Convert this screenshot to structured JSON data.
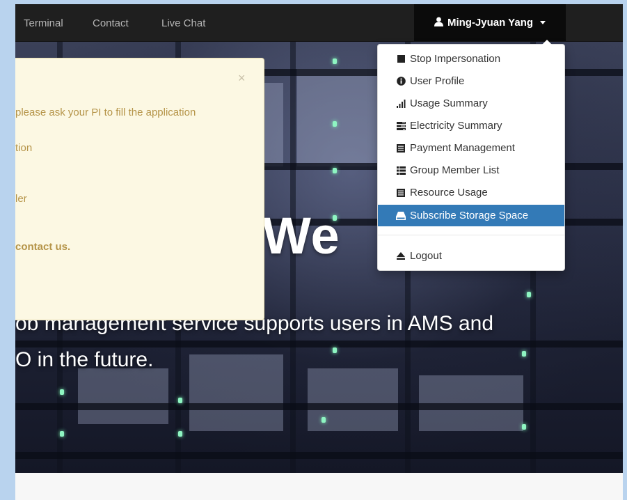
{
  "navbar": {
    "links": [
      "Terminal",
      "Contact",
      "Live Chat"
    ],
    "user_name": "Ming-Jyuan Yang"
  },
  "alert": {
    "close": "×",
    "lines": [
      "please ask your PI to fill the application",
      "tion",
      "ler",
      "contact us."
    ]
  },
  "hero": {
    "big_text": "We",
    "line1": "ob management service supports users in AMS and",
    "line2": "O in the future."
  },
  "user_menu": {
    "items": [
      {
        "label": "Stop Impersonation",
        "icon": "stop-icon"
      },
      {
        "label": "User Profile",
        "icon": "info-circle-icon"
      },
      {
        "label": "Usage Summary",
        "icon": "signal-bars-icon"
      },
      {
        "label": "Electricity Summary",
        "icon": "tasks-icon"
      },
      {
        "label": "Payment Management",
        "icon": "list-alt-icon"
      },
      {
        "label": "Group Member List",
        "icon": "th-list-icon"
      },
      {
        "label": "Resource Usage",
        "icon": "list-alt-icon"
      },
      {
        "label": "Subscribe Storage Space",
        "icon": "hdd-icon"
      }
    ],
    "logout": "Logout",
    "active_item": "Subscribe Storage Space",
    "active_color": "#337ab7"
  }
}
